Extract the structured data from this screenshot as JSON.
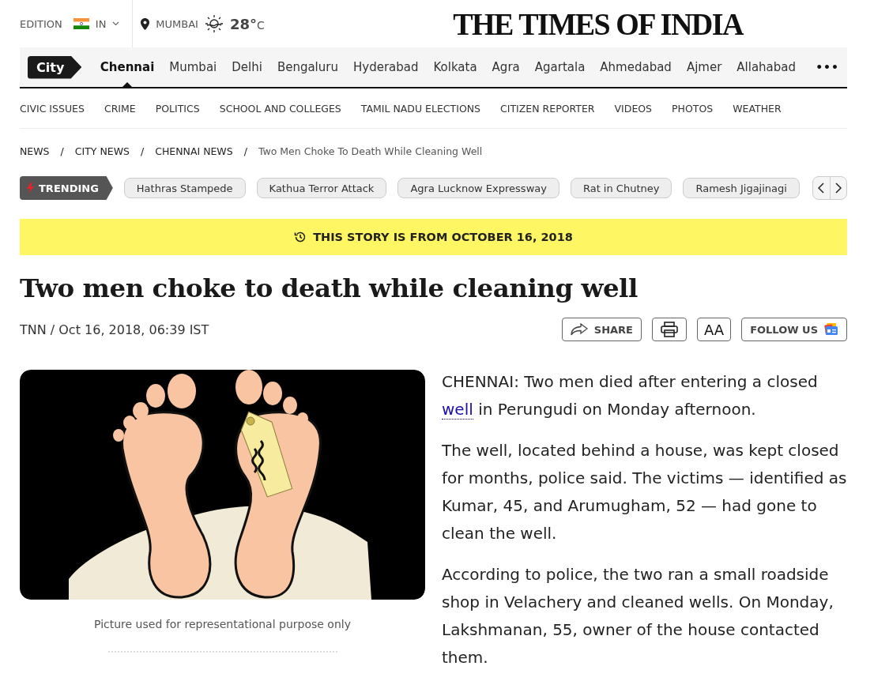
{
  "header": {
    "edition_label": "EDITION",
    "edition": "IN",
    "city": "MUMBAI",
    "temperature": "28°",
    "unit": "C",
    "logo": "THE TIMES OF INDIA"
  },
  "city_nav": {
    "badge": "City",
    "items": [
      {
        "label": "Chennai",
        "selected": true
      },
      {
        "label": "Mumbai",
        "selected": false
      },
      {
        "label": "Delhi",
        "selected": false
      },
      {
        "label": "Bengaluru",
        "selected": false
      },
      {
        "label": "Hyderabad",
        "selected": false
      },
      {
        "label": "Kolkata",
        "selected": false
      },
      {
        "label": "Agra",
        "selected": false
      },
      {
        "label": "Agartala",
        "selected": false
      },
      {
        "label": "Ahmedabad",
        "selected": false
      },
      {
        "label": "Ajmer",
        "selected": false
      },
      {
        "label": "Allahabad",
        "selected": false
      }
    ],
    "more": "•••"
  },
  "sub_nav": [
    "CIVIC ISSUES",
    "CRIME",
    "POLITICS",
    "SCHOOL AND COLLEGES",
    "TAMIL NADU ELECTIONS",
    "CITIZEN REPORTER",
    "VIDEOS",
    "PHOTOS",
    "WEATHER"
  ],
  "breadcrumbs": [
    {
      "label": "NEWS",
      "separator": "/"
    },
    {
      "label": "CITY NEWS",
      "separator": "/"
    },
    {
      "label": "CHENNAI NEWS",
      "separator": "/"
    },
    {
      "label": "Two Men Choke To Death While Cleaning Well"
    }
  ],
  "trending": {
    "label": "TRENDING",
    "topics": [
      "Hathras Stampede",
      "Kathua Terror Attack",
      "Agra Lucknow Expressway",
      "Rat in Chutney",
      "Ramesh Jigajinagi"
    ]
  },
  "banner": "THIS STORY IS FROM OCTOBER 16, 2018",
  "article": {
    "headline": "Two men choke to death while cleaning well",
    "byline": "TNN / Oct 16, 2018, 06:39 IST",
    "actions": {
      "share": "SHARE",
      "font_size": "AA",
      "follow": "FOLLOW US"
    },
    "caption": "Picture used for representational purpose only",
    "paragraphs": [
      {
        "text_before": "CHENNAI: Two men died after entering a closed ",
        "link": "well",
        "text_after": " in Perungudi on Monday afternoon."
      },
      {
        "text_before": "The well, located behind a house, was kept closed for months, police said. The victims — identified as Kumar, 45, and Arumugham, 52 — had gone to clean the well."
      },
      {
        "text_before": "According to police, the two ran a small roadside shop in Velachery and cleaned wells. On Monday, Lakshmanan, 55, owner of the house contacted them."
      }
    ]
  }
}
